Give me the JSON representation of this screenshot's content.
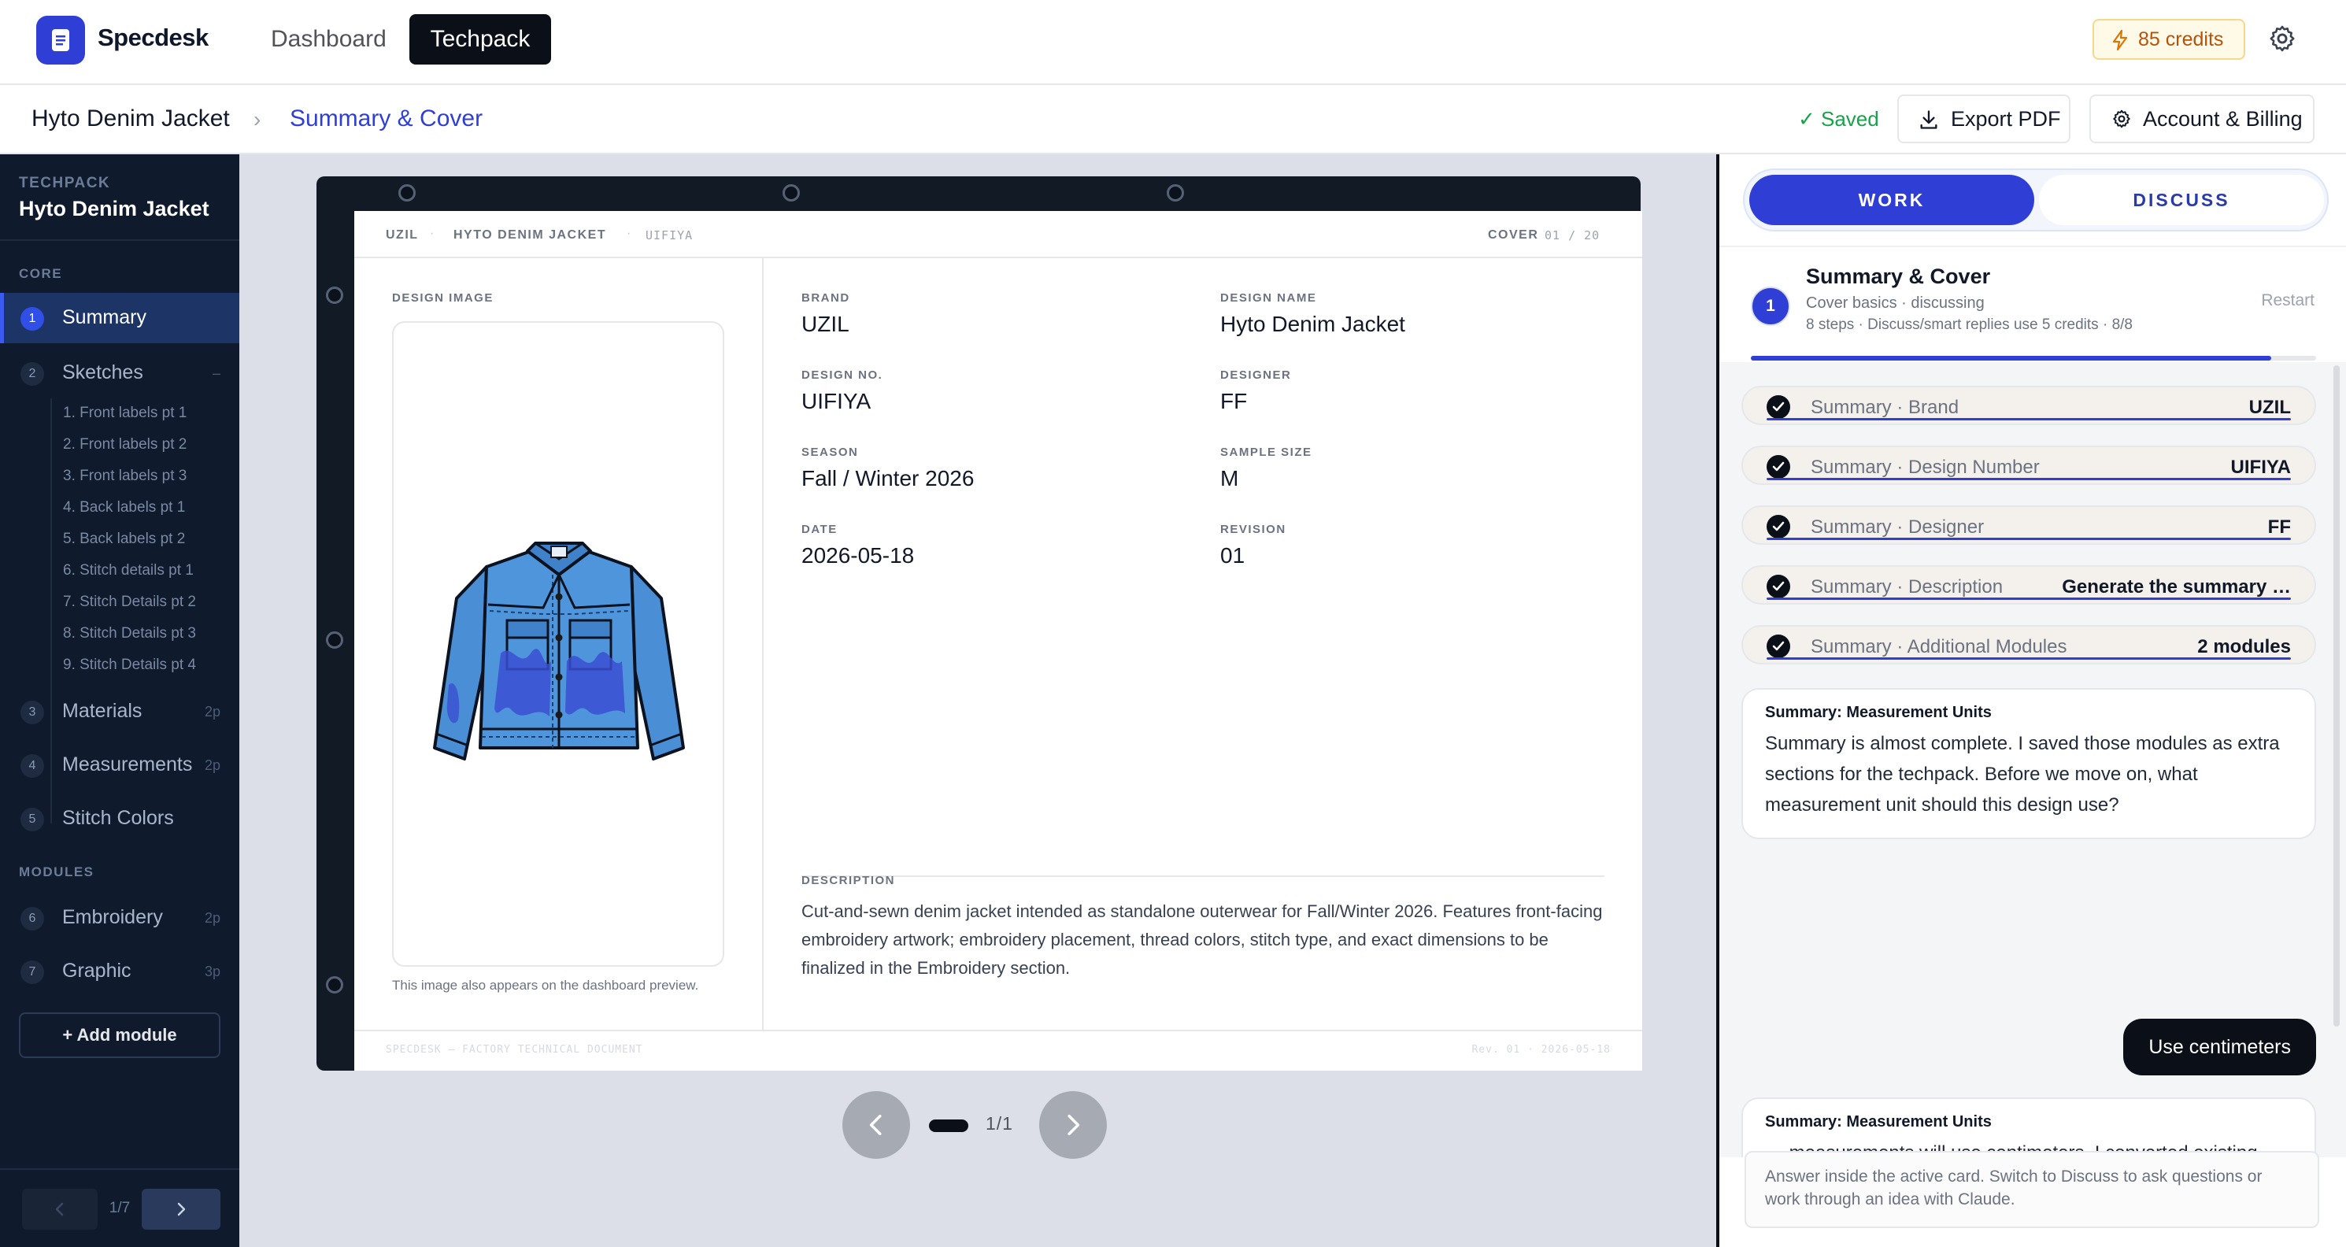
{
  "app": {
    "brand": "Specdesk",
    "nav": {
      "dashboard": "Dashboard",
      "techpack": "Techpack"
    },
    "credits": "85 credits"
  },
  "breadcrumb": {
    "project": "Hyto Denim Jacket",
    "separator": "›",
    "current": "Summary & Cover",
    "saved": "✓ Saved",
    "export_label": "Export PDF",
    "account_label": "Account & Billing"
  },
  "sidebar": {
    "kicker": "TECHPACK",
    "project": "Hyto Denim Jacket",
    "core_label": "CORE",
    "modules_label": "MODULES",
    "core_items": [
      {
        "num": "1",
        "label": "Summary",
        "meta": ""
      },
      {
        "num": "2",
        "label": "Sketches",
        "meta": "–"
      },
      {
        "num": "3",
        "label": "Materials",
        "meta": "2p"
      },
      {
        "num": "4",
        "label": "Measurements",
        "meta": "2p"
      },
      {
        "num": "5",
        "label": "Stitch Colors",
        "meta": ""
      }
    ],
    "sketch_subitems": [
      "1. Front labels pt 1",
      "2. Front labels pt 2",
      "3. Front labels pt 3",
      "4. Back labels pt 1",
      "5. Back labels pt 2",
      "6. Stitch details pt 1",
      "7. Stitch Details pt 2",
      "8. Stitch Details pt 3",
      "9. Stitch Details pt 4"
    ],
    "module_items": [
      {
        "num": "6",
        "label": "Embroidery",
        "meta": "2p"
      },
      {
        "num": "7",
        "label": "Graphic",
        "meta": "3p"
      }
    ],
    "add_module": "+ Add module",
    "page_indicator": "1/7"
  },
  "sheet": {
    "header": {
      "brand": "UZIL",
      "title": "HYTO DENIM JACKET",
      "code": "UIFIYA",
      "section": "COVER",
      "page": "01 / 20"
    },
    "design_image_label": "DESIGN IMAGE",
    "image_caption": "This image also appears on the dashboard preview.",
    "fields": {
      "brand": {
        "label": "BRAND",
        "value": "UZIL"
      },
      "design_name": {
        "label": "DESIGN NAME",
        "value": "Hyto Denim Jacket"
      },
      "design_no": {
        "label": "DESIGN NO.",
        "value": "UIFIYA"
      },
      "designer": {
        "label": "DESIGNER",
        "value": "FF"
      },
      "season": {
        "label": "SEASON",
        "value": "Fall / Winter 2026"
      },
      "sample_size": {
        "label": "SAMPLE SIZE",
        "value": "M"
      },
      "date": {
        "label": "DATE",
        "value": "2026-05-18"
      },
      "revision": {
        "label": "REVISION",
        "value": "01"
      }
    },
    "description_label": "DESCRIPTION",
    "description": "Cut-and-sewn denim jacket intended as standalone outerwear for Fall/Winter 2026. Features front-facing embroidery artwork; embroidery placement, thread colors, stitch type, and exact dimensions to be finalized in the Embroidery section.",
    "footer_left": "SPECDESK — FACTORY TECHNICAL DOCUMENT",
    "footer_right": "Rev. 01 · 2026-05-18"
  },
  "viewer_pager": {
    "count": "1/1"
  },
  "panel": {
    "tabs": {
      "work": "WORK",
      "discuss": "DISCUSS"
    },
    "step": {
      "num": "1",
      "title": "Summary & Cover",
      "subtitle": "Cover basics · discussing",
      "meta": "8 steps · Discuss/smart replies use 5 credits · 8/8",
      "restart": "Restart",
      "progress": 0.92
    },
    "fields": [
      {
        "label": "Summary · Brand",
        "value": "UZIL"
      },
      {
        "label": "Summary · Design Number",
        "value": "UIFIYA"
      },
      {
        "label": "Summary · Designer",
        "value": "FF"
      },
      {
        "label": "Summary · Description",
        "value": "Generate the summary …"
      },
      {
        "label": "Summary · Additional Modules",
        "value": "2 modules"
      }
    ],
    "messages": [
      {
        "title": "Summary: Measurement Units",
        "body": "Summary is almost complete. I saved those modules as extra sections for the techpack. Before we move on, what measurement unit should this design use?"
      },
      {
        "title": "Summary: Measurement Units",
        "body": "— measurements will use centimeters. I converted existing measurement values where there were numbers. You can edit any measurement cell directly if something needs adjustment."
      }
    ],
    "user_reply": "Use centimeters",
    "composer_placeholder": "Answer inside the active card. Switch to Discuss to ask questions or work through an idea with Claude."
  },
  "colors": {
    "accent": "#2f3fd6",
    "sidebar_bg": "#0f1a2c",
    "saved_green": "#16a34a",
    "denim": "#4a8fd6"
  },
  "icons": [
    "document-icon",
    "bolt-icon",
    "gear-icon",
    "download-icon",
    "check-icon",
    "chevron-left-icon",
    "chevron-right-icon",
    "plus-icon"
  ]
}
